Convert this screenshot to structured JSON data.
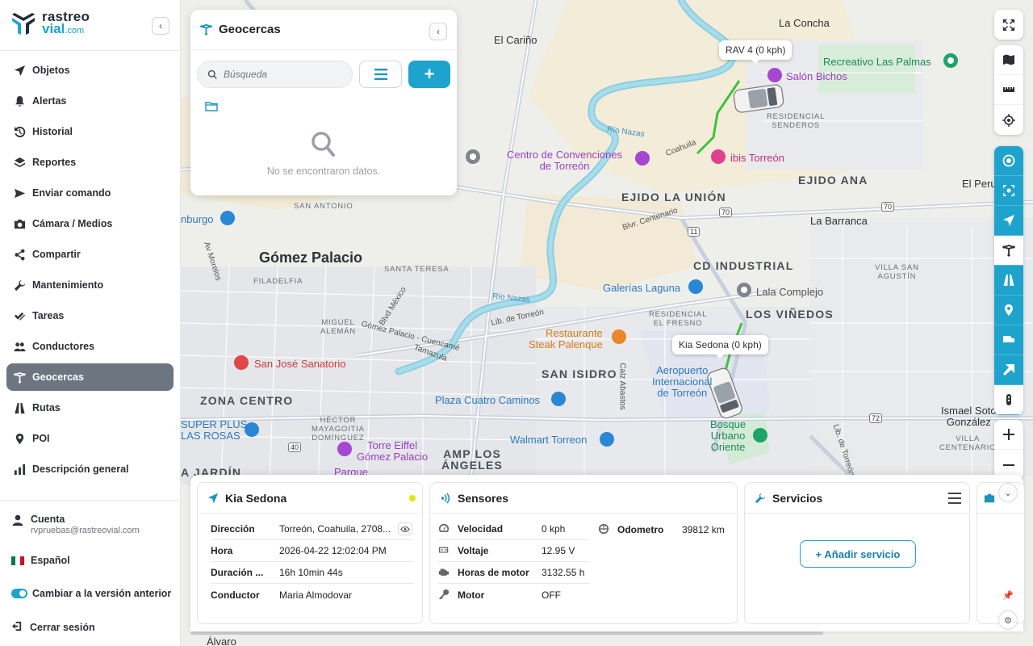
{
  "brand": {
    "line1": "rastreo",
    "line2": "vial",
    "domain": ".com"
  },
  "sidebar": {
    "items": [
      {
        "label": "Objetos",
        "icon": "navigation-arrow-icon"
      },
      {
        "label": "Alertas",
        "icon": "bell-icon"
      },
      {
        "label": "Historial",
        "icon": "history-icon"
      },
      {
        "label": "Reportes",
        "icon": "layers-icon"
      },
      {
        "label": "Enviar comando",
        "icon": "send-icon"
      },
      {
        "label": "Cámara / Medios",
        "icon": "camera-icon"
      },
      {
        "label": "Compartir",
        "icon": "share-icon"
      },
      {
        "label": "Mantenimiento",
        "icon": "wrench-icon"
      },
      {
        "label": "Tareas",
        "icon": "checklist-icon"
      },
      {
        "label": "Conductores",
        "icon": "users-icon"
      },
      {
        "label": "Geocercas",
        "icon": "geofence-icon",
        "active": true
      },
      {
        "label": "Rutas",
        "icon": "route-icon"
      },
      {
        "label": "POI",
        "icon": "map-pin-icon"
      },
      {
        "label": "Descripción general",
        "icon": "bar-chart-icon"
      }
    ],
    "account": {
      "label": "Cuenta",
      "email": "rvpruebas@rastreovial.com"
    },
    "language": "Español",
    "switch_version": "Cambiar a la versión anterior",
    "logout": "Cerrar sesión"
  },
  "geocercas": {
    "title": "Geocercas",
    "search_placeholder": "Búsqueda",
    "empty_message": "No se encontraron datos."
  },
  "map": {
    "labels": {
      "el_carino": "El Cariño",
      "la_concha": "La Concha",
      "recreativo": "Recreativo Las Palmas",
      "salon_bichos": "Salón Bichos",
      "residencial_senderos": "RESIDENCIAL\nSENDEROS",
      "rio_nazas_1": "Río Nazas",
      "rio_nazas_2": "Río Nazas",
      "centro_convenciones": "Centro de Convenciones\nde Torreón",
      "coahuila": "Coahuila",
      "ibis": "ibis Torreón",
      "ejido_la_union": "EJIDO LA UNIÓN",
      "ejido_ana": "EJIDO ANA",
      "el_peru": "El Peru",
      "san_antonio": "SAN ANTONIO",
      "burgo": "nburgo",
      "blvr_centenario": "Blvr. Centenario",
      "la_barranca": "La Barranca",
      "gomez_palacio": "Gómez Palacio",
      "av_morelos": "Av Morelos",
      "santa_teresa": "SANTA TERESA",
      "filadelfia": "FILADELFIA",
      "cd_industrial": "CD INDUSTRIAL",
      "villa_san_agustin": "VILLA SAN\nAGUSTÍN",
      "galerias": "Galerías Laguna",
      "lala": "Lala Complejo",
      "blvd_mexico": "Blvd México",
      "residencial_el_fresno": "RESIDENCIAL\nEL FRESNO",
      "los_vinedos": "LOS VIÑEDOS",
      "miguel_aleman": "MIGUEL\nALEMÁN",
      "gomez_cuencame": "Gómez Palacio - Cuencamé",
      "lib_torreon_1": "Lib. de Torreón",
      "restaurante": "Restaurante\nSteak Palenque",
      "tamazula": "Tamazula",
      "san_jose": "San José Sanatorio",
      "san_isidro": "SAN ISIDRO",
      "calz_abastos": "Calz Abastos",
      "aeropuerto": "Aeropuerto\nInternacional\nde Torreón",
      "ismael": "Ismael Soto\nGonzález",
      "zona_centro": "ZONA CENTRO",
      "plaza_cuatro": "Plaza Cuatro Caminos",
      "hector": "HÉCTOR\nMAYAGOITIA\nDOMÍNGUEZ",
      "super_plus": "SUPER PLUS\nLAS ROSAS",
      "torre_eiffel": "Torre Eiffel\nGómez Palacio",
      "walmart": "Walmart Torreon",
      "bosque": "Bosque\nUrbano\nOriente",
      "villa_cent": "VILLA\nCENTENARIO",
      "lib_torreon_2": "Lib. de Torreón",
      "amp_angeles": "AMP LOS\nÁNGELES",
      "jardin": "A JARDÍN",
      "parque": "Parque",
      "alvaro": "Álvaro"
    },
    "shields": [
      "70",
      "70",
      "11",
      "40",
      "72"
    ],
    "vehicles": [
      {
        "tooltip": "RAV 4 (0 kph)"
      },
      {
        "tooltip": "Kia Sedona (0 kph)"
      }
    ]
  },
  "vehicle_card": {
    "title": "Kia Sedona",
    "rows": [
      {
        "key": "Dirección",
        "value": "Torreón, Coahuila, 2708..."
      },
      {
        "key": "Hora",
        "value": "2026-04-22 12:02:04 PM"
      },
      {
        "key": "Duración ...",
        "value": "16h 10min 44s"
      },
      {
        "key": "Conductor",
        "value": "Maria Almodovar"
      }
    ]
  },
  "sensors_card": {
    "title": "Sensores",
    "left": [
      {
        "key": "Velocidad",
        "value": "0 kph",
        "icon": "speedometer-icon"
      },
      {
        "key": "Voltaje",
        "value": "12.95 V",
        "icon": "battery-icon"
      },
      {
        "key": "Horas de motor",
        "value": "3132.55 h",
        "icon": "engine-icon"
      },
      {
        "key": "Motor",
        "value": "OFF",
        "icon": "key-icon"
      }
    ],
    "right": [
      {
        "key": "Odometro",
        "value": "39812 km",
        "icon": "odometer-icon"
      }
    ]
  },
  "services_card": {
    "title": "Servicios",
    "add_label": "+ Añadir servicio"
  },
  "colors": {
    "accent": "#1ea3cd",
    "active_menu": "#6c7580",
    "route_green": "#3bc43b"
  }
}
